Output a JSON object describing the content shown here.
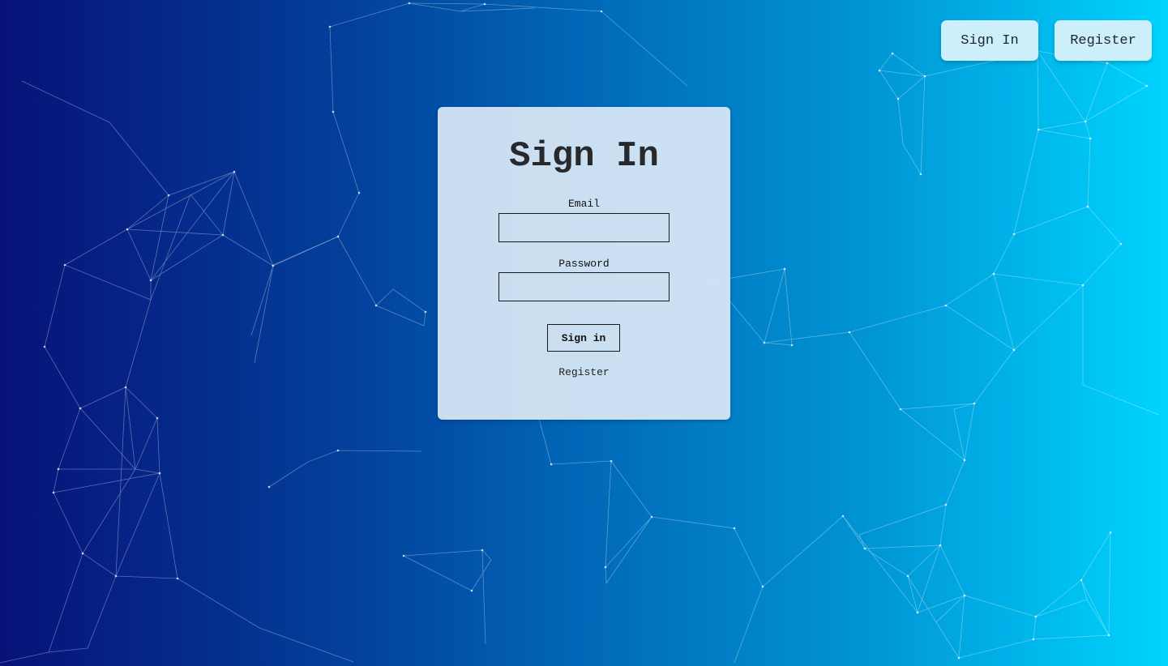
{
  "nav": {
    "signin_label": "Sign In",
    "register_label": "Register"
  },
  "form": {
    "title": "Sign In",
    "email_label": "Email",
    "email_value": "",
    "password_label": "Password",
    "password_value": "",
    "submit_label": "Sign in",
    "register_link": "Register"
  },
  "colors": {
    "gradient_start": "#071278",
    "gradient_end": "#00d4ff",
    "card_background": "#d6e6f4",
    "nav_button_background": "#cdeefb"
  }
}
